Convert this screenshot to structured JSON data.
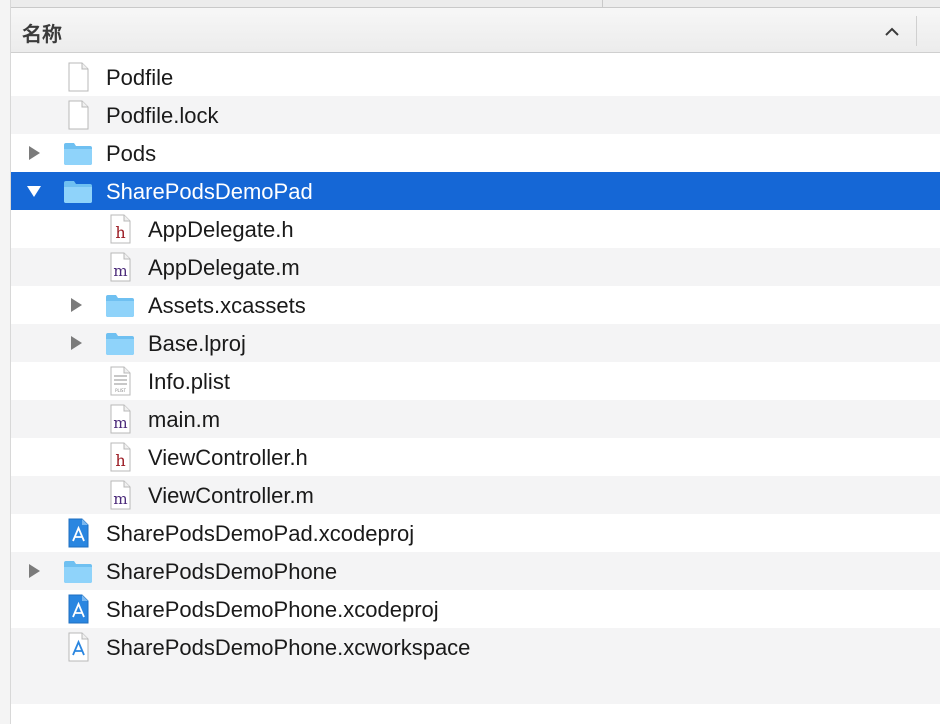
{
  "header": {
    "title": "名称",
    "sort_icon": "chevron-up-icon"
  },
  "rows": [
    {
      "label": "Podfile",
      "icon": "document-icon",
      "level": 0,
      "disclosure": "none"
    },
    {
      "label": "Podfile.lock",
      "icon": "document-icon",
      "level": 0,
      "disclosure": "none"
    },
    {
      "label": "Pods",
      "icon": "folder-icon",
      "level": 0,
      "disclosure": "collapsed"
    },
    {
      "label": "SharePodsDemoPad",
      "icon": "folder-icon",
      "level": 0,
      "disclosure": "expanded",
      "selected": true
    },
    {
      "label": "AppDelegate.h",
      "icon": "header-file-icon",
      "icon_letter": "h",
      "level": 1,
      "disclosure": "none"
    },
    {
      "label": "AppDelegate.m",
      "icon": "objc-source-file-icon",
      "icon_letter": "m",
      "level": 1,
      "disclosure": "none"
    },
    {
      "label": "Assets.xcassets",
      "icon": "folder-icon",
      "level": 1,
      "disclosure": "collapsed"
    },
    {
      "label": "Base.lproj",
      "icon": "folder-icon",
      "level": 1,
      "disclosure": "collapsed"
    },
    {
      "label": "Info.plist",
      "icon": "plist-file-icon",
      "icon_letter": "PLIST",
      "level": 1,
      "disclosure": "none"
    },
    {
      "label": "main.m",
      "icon": "objc-source-file-icon",
      "icon_letter": "m",
      "level": 1,
      "disclosure": "none"
    },
    {
      "label": "ViewController.h",
      "icon": "header-file-icon",
      "icon_letter": "h",
      "level": 1,
      "disclosure": "none"
    },
    {
      "label": "ViewController.m",
      "icon": "objc-source-file-icon",
      "icon_letter": "m",
      "level": 1,
      "disclosure": "none"
    },
    {
      "label": "SharePodsDemoPad.xcodeproj",
      "icon": "xcodeproj-icon",
      "level": 0,
      "disclosure": "none"
    },
    {
      "label": "SharePodsDemoPhone",
      "icon": "folder-icon",
      "level": 0,
      "disclosure": "collapsed"
    },
    {
      "label": "SharePodsDemoPhone.xcodeproj",
      "icon": "xcodeproj-icon",
      "level": 0,
      "disclosure": "none"
    },
    {
      "label": "SharePodsDemoPhone.xcworkspace",
      "icon": "xcworkspace-icon",
      "level": 0,
      "disclosure": "none"
    }
  ],
  "colors": {
    "selection": "#1567d6",
    "folder": "#6fc0f1",
    "header_letter": "#9b1c24",
    "source_letter": "#4b2a7a"
  }
}
